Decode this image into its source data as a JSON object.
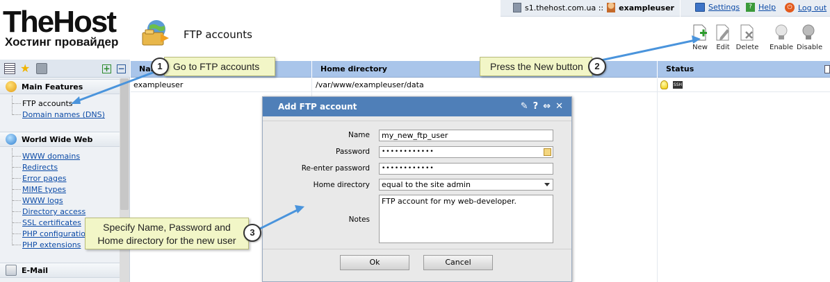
{
  "logo": {
    "brand": "TheHost",
    "tagline": "Хостинг провайдер"
  },
  "page": {
    "title": "FTP accounts"
  },
  "topbar": {
    "server": "s1.thehost.com.ua ::",
    "user": "exampleuser",
    "settings": "Settings",
    "help": "Help",
    "logout": "Log out"
  },
  "toolbar": {
    "new": "New",
    "edit": "Edit",
    "delete": "Delete",
    "enable": "Enable",
    "disable": "Disable"
  },
  "sidebar": {
    "sections": [
      {
        "title": "Main Features",
        "items": [
          "FTP accounts",
          "Domain names (DNS)"
        ]
      },
      {
        "title": "World Wide Web",
        "items": [
          "WWW domains",
          "Redirects",
          "Error pages",
          "MIME types",
          "WWW logs",
          "Directory access",
          "SSL certificates",
          "PHP configuration",
          "PHP extensions"
        ]
      },
      {
        "title": "E-Mail",
        "items": []
      }
    ]
  },
  "table": {
    "columns": [
      "Name",
      "Home directory",
      "Status"
    ],
    "rows": [
      {
        "name": "exampleuser",
        "home": "/var/www/exampleuser/data",
        "status_icons": [
          "bulb-icon",
          "ssh-icon"
        ]
      }
    ]
  },
  "dialog": {
    "title": "Add FTP account",
    "fields": {
      "name_label": "Name",
      "name_value": "my_new_ftp_user",
      "password_label": "Password",
      "password_value": "••••••••••••",
      "reenter_label": "Re-enter password",
      "reenter_value": "••••••••••••",
      "homedir_label": "Home directory",
      "homedir_value": "equal to the site admin",
      "notes_label": "Notes",
      "notes_value": "FTP account for my web-developer."
    },
    "ok": "Ok",
    "cancel": "Cancel"
  },
  "callouts": {
    "c1": {
      "num": "1",
      "text": "Go to FTP accounts"
    },
    "c2": {
      "num": "2",
      "text": "Press the New button"
    },
    "c3": {
      "num": "3",
      "text_line1": "Specify Name, Password and",
      "text_line2": "Home directory for the new user"
    }
  },
  "colors": {
    "header_blue": "#a9c5ea",
    "dialog_title": "#4f7fb8",
    "callout_bg": "#f2f6c7",
    "link": "#0b4aa6"
  }
}
